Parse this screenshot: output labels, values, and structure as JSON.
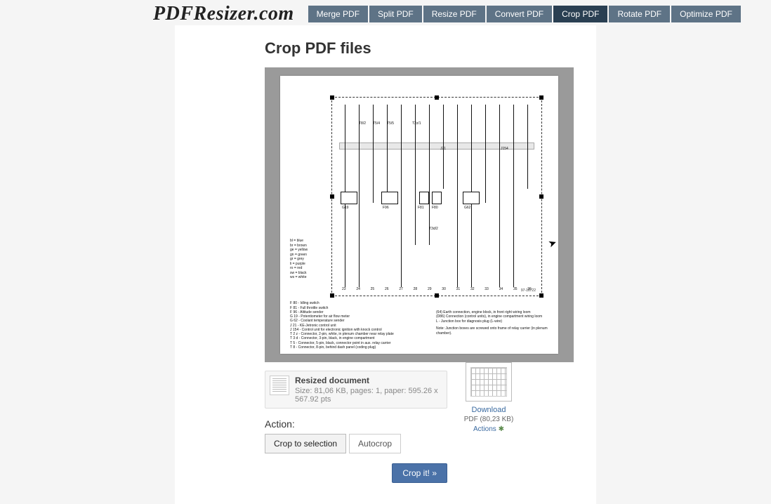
{
  "brand": "PDFResizer.com",
  "nav": [
    {
      "label": "Merge PDF",
      "active": false
    },
    {
      "label": "Split PDF",
      "active": false
    },
    {
      "label": "Resize PDF",
      "active": false
    },
    {
      "label": "Convert PDF",
      "active": false
    },
    {
      "label": "Crop PDF",
      "active": true
    },
    {
      "label": "Rotate PDF",
      "active": false
    },
    {
      "label": "Optimize PDF",
      "active": false
    }
  ],
  "page_title": "Crop PDF files",
  "doc": {
    "title": "Resized document",
    "meta": "Size: 81,06 KB, pages: 1, paper: 595.26 x 567.92 pts"
  },
  "action_label": "Action:",
  "actions": {
    "crop_to_selection": "Crop to selection",
    "autocrop": "Autocrop",
    "submit": "Crop it! »"
  },
  "download": {
    "link": "Download",
    "meta": "PDF (80,23 KB)",
    "actions": "Actions"
  },
  "schematic": {
    "color_legend": [
      "bl  =  blue",
      "br  =  brown",
      "ge  =  yellow",
      "gn  =  green",
      "gr  =  grey",
      "li  =  purple",
      "ro  =  red",
      "sw  =  black",
      "ws  =  white"
    ],
    "footnotes_left": [
      "F 80  -  Idling switch",
      "F 81  -  Full throttle switch",
      "F 96  -  Altitude sender",
      "G 19  -  Potentiometer for air flow meter",
      "G 62  -  Coolant temperature sender",
      "J 21  -  KE-Jetronic control unit",
      "J 154 -  Control unit for electronic ignition with knock control",
      "T 2 z  -  Connector, 2-pin, white, in plenum chamber near relay plate",
      "T 3 d  -  Connector, 3-pin, black, in engine compartment",
      "T 5    -  Connector, 5-pin, black, connector point in aux. relay carrier",
      "T 8    -  Connector, 8-pin, behind dash panel (coding plug)"
    ],
    "footnotes_right": [
      "(64)   Earth connection, engine block, in front right wiring loom",
      "(D86)  Connection (control units), in engine compartment wiring loom",
      "L   -  Junction box for diagnosis plug (L-wire)",
      "Note:  Junction boxes are screwed onto frame of relay carrier (in plenum chamber)."
    ],
    "top_labels": [
      "T8/2",
      "T5/4",
      "T5/5",
      "T2z/1",
      "J21",
      "J154"
    ],
    "mid_labels": [
      "G19",
      "F96",
      "F81",
      "F80",
      "T3d/2",
      "G62"
    ],
    "axis_numbers": [
      "23",
      "24",
      "25",
      "26",
      "27",
      "28",
      "29",
      "30",
      "31",
      "32",
      "33",
      "34",
      "35",
      "36"
    ],
    "sheet_id": "97-16722"
  }
}
